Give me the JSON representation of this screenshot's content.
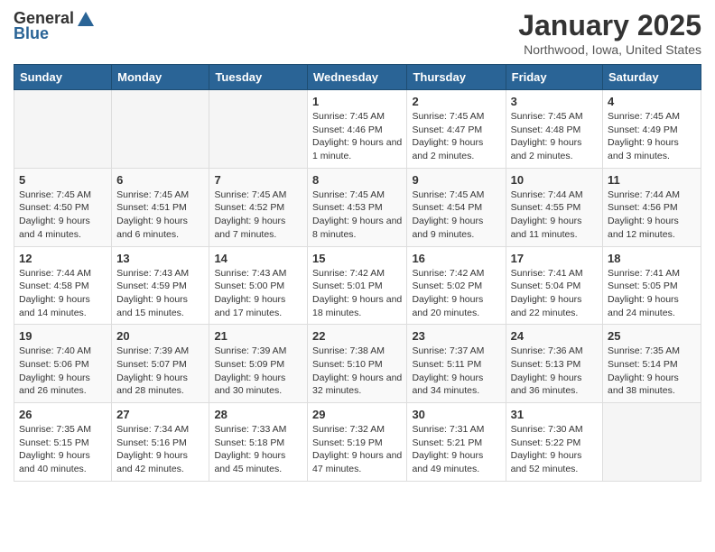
{
  "header": {
    "logo_general": "General",
    "logo_blue": "Blue",
    "month_title": "January 2025",
    "location": "Northwood, Iowa, United States"
  },
  "weekdays": [
    "Sunday",
    "Monday",
    "Tuesday",
    "Wednesday",
    "Thursday",
    "Friday",
    "Saturday"
  ],
  "weeks": [
    [
      {
        "day": "",
        "info": ""
      },
      {
        "day": "",
        "info": ""
      },
      {
        "day": "",
        "info": ""
      },
      {
        "day": "1",
        "info": "Sunrise: 7:45 AM\nSunset: 4:46 PM\nDaylight: 9 hours and 1 minute."
      },
      {
        "day": "2",
        "info": "Sunrise: 7:45 AM\nSunset: 4:47 PM\nDaylight: 9 hours and 2 minutes."
      },
      {
        "day": "3",
        "info": "Sunrise: 7:45 AM\nSunset: 4:48 PM\nDaylight: 9 hours and 2 minutes."
      },
      {
        "day": "4",
        "info": "Sunrise: 7:45 AM\nSunset: 4:49 PM\nDaylight: 9 hours and 3 minutes."
      }
    ],
    [
      {
        "day": "5",
        "info": "Sunrise: 7:45 AM\nSunset: 4:50 PM\nDaylight: 9 hours and 4 minutes."
      },
      {
        "day": "6",
        "info": "Sunrise: 7:45 AM\nSunset: 4:51 PM\nDaylight: 9 hours and 6 minutes."
      },
      {
        "day": "7",
        "info": "Sunrise: 7:45 AM\nSunset: 4:52 PM\nDaylight: 9 hours and 7 minutes."
      },
      {
        "day": "8",
        "info": "Sunrise: 7:45 AM\nSunset: 4:53 PM\nDaylight: 9 hours and 8 minutes."
      },
      {
        "day": "9",
        "info": "Sunrise: 7:45 AM\nSunset: 4:54 PM\nDaylight: 9 hours and 9 minutes."
      },
      {
        "day": "10",
        "info": "Sunrise: 7:44 AM\nSunset: 4:55 PM\nDaylight: 9 hours and 11 minutes."
      },
      {
        "day": "11",
        "info": "Sunrise: 7:44 AM\nSunset: 4:56 PM\nDaylight: 9 hours and 12 minutes."
      }
    ],
    [
      {
        "day": "12",
        "info": "Sunrise: 7:44 AM\nSunset: 4:58 PM\nDaylight: 9 hours and 14 minutes."
      },
      {
        "day": "13",
        "info": "Sunrise: 7:43 AM\nSunset: 4:59 PM\nDaylight: 9 hours and 15 minutes."
      },
      {
        "day": "14",
        "info": "Sunrise: 7:43 AM\nSunset: 5:00 PM\nDaylight: 9 hours and 17 minutes."
      },
      {
        "day": "15",
        "info": "Sunrise: 7:42 AM\nSunset: 5:01 PM\nDaylight: 9 hours and 18 minutes."
      },
      {
        "day": "16",
        "info": "Sunrise: 7:42 AM\nSunset: 5:02 PM\nDaylight: 9 hours and 20 minutes."
      },
      {
        "day": "17",
        "info": "Sunrise: 7:41 AM\nSunset: 5:04 PM\nDaylight: 9 hours and 22 minutes."
      },
      {
        "day": "18",
        "info": "Sunrise: 7:41 AM\nSunset: 5:05 PM\nDaylight: 9 hours and 24 minutes."
      }
    ],
    [
      {
        "day": "19",
        "info": "Sunrise: 7:40 AM\nSunset: 5:06 PM\nDaylight: 9 hours and 26 minutes."
      },
      {
        "day": "20",
        "info": "Sunrise: 7:39 AM\nSunset: 5:07 PM\nDaylight: 9 hours and 28 minutes."
      },
      {
        "day": "21",
        "info": "Sunrise: 7:39 AM\nSunset: 5:09 PM\nDaylight: 9 hours and 30 minutes."
      },
      {
        "day": "22",
        "info": "Sunrise: 7:38 AM\nSunset: 5:10 PM\nDaylight: 9 hours and 32 minutes."
      },
      {
        "day": "23",
        "info": "Sunrise: 7:37 AM\nSunset: 5:11 PM\nDaylight: 9 hours and 34 minutes."
      },
      {
        "day": "24",
        "info": "Sunrise: 7:36 AM\nSunset: 5:13 PM\nDaylight: 9 hours and 36 minutes."
      },
      {
        "day": "25",
        "info": "Sunrise: 7:35 AM\nSunset: 5:14 PM\nDaylight: 9 hours and 38 minutes."
      }
    ],
    [
      {
        "day": "26",
        "info": "Sunrise: 7:35 AM\nSunset: 5:15 PM\nDaylight: 9 hours and 40 minutes."
      },
      {
        "day": "27",
        "info": "Sunrise: 7:34 AM\nSunset: 5:16 PM\nDaylight: 9 hours and 42 minutes."
      },
      {
        "day": "28",
        "info": "Sunrise: 7:33 AM\nSunset: 5:18 PM\nDaylight: 9 hours and 45 minutes."
      },
      {
        "day": "29",
        "info": "Sunrise: 7:32 AM\nSunset: 5:19 PM\nDaylight: 9 hours and 47 minutes."
      },
      {
        "day": "30",
        "info": "Sunrise: 7:31 AM\nSunset: 5:21 PM\nDaylight: 9 hours and 49 minutes."
      },
      {
        "day": "31",
        "info": "Sunrise: 7:30 AM\nSunset: 5:22 PM\nDaylight: 9 hours and 52 minutes."
      },
      {
        "day": "",
        "info": ""
      }
    ]
  ]
}
